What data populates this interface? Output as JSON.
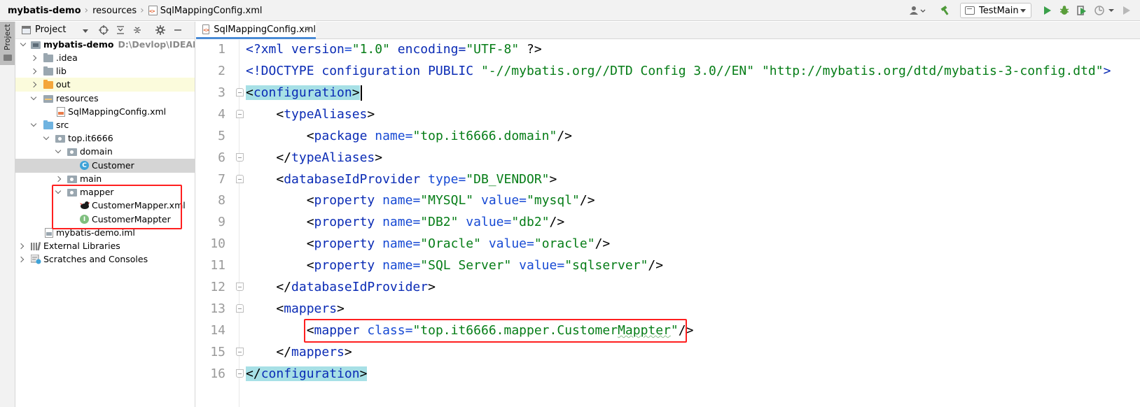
{
  "breadcrumb": {
    "project": "mybatis-demo",
    "folder": "resources",
    "file": "SqlMappingConfig.xml"
  },
  "toolbar": {
    "run_config": "TestMain",
    "icons": [
      "user-icon",
      "build-hammer-icon",
      "run-icon",
      "debug-icon",
      "coverage-icon",
      "profile-icon",
      "more-run-icon"
    ]
  },
  "tool_strip": {
    "label": "Project"
  },
  "project_panel": {
    "title": "Project",
    "icons": [
      "locate-icon",
      "expand-all-icon",
      "collapse-all-icon",
      "settings-gear-icon",
      "hide-icon"
    ],
    "tree": [
      {
        "label": "mybatis-demo",
        "path": "D:\\Devlop\\IDEAProje",
        "bold": true
      },
      {
        "label": ".idea"
      },
      {
        "label": "lib"
      },
      {
        "label": "out"
      },
      {
        "label": "resources"
      },
      {
        "label": "SqlMappingConfig.xml"
      },
      {
        "label": "src"
      },
      {
        "label": "top.it6666"
      },
      {
        "label": "domain"
      },
      {
        "label": "Customer"
      },
      {
        "label": "main"
      },
      {
        "label": "mapper"
      },
      {
        "label": "CustomerMapper.xml"
      },
      {
        "label": "CustomerMappter"
      },
      {
        "label": "mybatis-demo.iml"
      },
      {
        "label": "External Libraries"
      },
      {
        "label": "Scratches and Consoles"
      }
    ]
  },
  "editor": {
    "tab_label": "SqlMappingConfig.xml",
    "lines": [
      {
        "n": "1"
      },
      {
        "n": "2"
      },
      {
        "n": "3"
      },
      {
        "n": "4"
      },
      {
        "n": "5"
      },
      {
        "n": "6"
      },
      {
        "n": "7"
      },
      {
        "n": "8"
      },
      {
        "n": "9"
      },
      {
        "n": "10"
      },
      {
        "n": "11"
      },
      {
        "n": "12"
      },
      {
        "n": "13"
      },
      {
        "n": "14"
      },
      {
        "n": "15"
      },
      {
        "n": "16"
      }
    ],
    "code": {
      "l1_a": "<?",
      "l1_b": "xml version",
      "l1_c": "=",
      "l1_d": "\"1.0\"",
      "l1_e": " encoding",
      "l1_f": "=",
      "l1_g": "\"UTF-8\"",
      "l1_h": " ?>",
      "l2_a": "<!DOCTYPE configuration PUBLIC ",
      "l2_b": "\"-//mybatis.org//DTD Config 3.0//EN\"",
      "l2_c": " ",
      "l2_d": "\"http://mybatis.org/dtd/mybatis-3-config.dtd\"",
      "l2_e": ">",
      "l3_a": "<",
      "l3_b": "configuration",
      "l3_c": ">",
      "l4_a": "    <",
      "l4_b": "typeAliases",
      "l4_c": ">",
      "l5_a": "        <",
      "l5_b": "package",
      "l5_c": " name",
      "l5_d": "=",
      "l5_e": "\"top.it6666.domain\"",
      "l5_f": "/>",
      "l6_a": "    </",
      "l6_b": "typeAliases",
      "l6_c": ">",
      "l7_a": "    <",
      "l7_b": "databaseIdProvider",
      "l7_c": " type",
      "l7_d": "=",
      "l7_e": "\"DB_VENDOR\"",
      "l7_f": ">",
      "l8_a": "        <",
      "l8_b": "property",
      "l8_c": " name",
      "l8_d": "=",
      "l8_e": "\"MYSQL\"",
      "l8_f": " value",
      "l8_g": "=",
      "l8_h": "\"mysql\"",
      "l8_i": "/>",
      "l9_a": "        <",
      "l9_b": "property",
      "l9_c": " name",
      "l9_d": "=",
      "l9_e": "\"DB2\"",
      "l9_f": " value",
      "l9_g": "=",
      "l9_h": "\"db2\"",
      "l9_i": "/>",
      "l10_a": "        <",
      "l10_b": "property",
      "l10_c": " name",
      "l10_d": "=",
      "l10_e": "\"Oracle\"",
      "l10_f": " value",
      "l10_g": "=",
      "l10_h": "\"oracle\"",
      "l10_i": "/>",
      "l11_a": "        <",
      "l11_b": "property",
      "l11_c": " name",
      "l11_d": "=",
      "l11_e": "\"SQL Server\"",
      "l11_f": " value",
      "l11_g": "=",
      "l11_h": "\"sqlserver\"",
      "l11_i": "/>",
      "l12_a": "    </",
      "l12_b": "databaseIdProvider",
      "l12_c": ">",
      "l13_a": "    <",
      "l13_b": "mappers",
      "l13_c": ">",
      "l14_a": "        <",
      "l14_b": "mapper",
      "l14_c": " class",
      "l14_d": "=",
      "l14_e1": "\"top.it6666.mapper.Customer",
      "l14_e2": "Mappter",
      "l14_e3": "\"",
      "l14_f": "/>",
      "l15_a": "    </",
      "l15_b": "mappers",
      "l15_c": ">",
      "l16_a": "</",
      "l16_b": "configuration",
      "l16_c": ">"
    }
  },
  "colors": {
    "tag": "#0a2bb5",
    "attr": "#174ad4",
    "string": "#067d17",
    "highlight_box": "#ff1f1f",
    "tab_underline": "#4a8bd6"
  }
}
